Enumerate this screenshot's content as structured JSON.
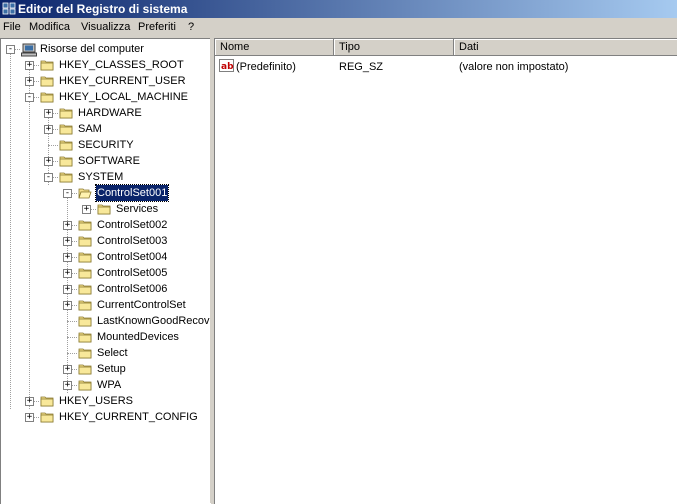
{
  "window": {
    "title": "Editor del Registro di sistema"
  },
  "menu": [
    "File",
    "Modifica",
    "Visualizza",
    "Preferiti",
    "?"
  ],
  "tree": [
    {
      "label": "Risorse del computer",
      "depth": 0,
      "expander": "-",
      "icon": "computer-icon"
    },
    {
      "label": "HKEY_CLASSES_ROOT",
      "depth": 1,
      "expander": "+"
    },
    {
      "label": "HKEY_CURRENT_USER",
      "depth": 1,
      "expander": "+"
    },
    {
      "label": "HKEY_LOCAL_MACHINE",
      "depth": 1,
      "expander": "-"
    },
    {
      "label": "HARDWARE",
      "depth": 2,
      "expander": "+"
    },
    {
      "label": "SAM",
      "depth": 2,
      "expander": "+"
    },
    {
      "label": "SECURITY",
      "depth": 2,
      "expander": ""
    },
    {
      "label": "SOFTWARE",
      "depth": 2,
      "expander": "+"
    },
    {
      "label": "SYSTEM",
      "depth": 2,
      "expander": "-"
    },
    {
      "label": "ControlSet001",
      "depth": 3,
      "expander": "-",
      "selected": true,
      "open": true
    },
    {
      "label": "Services",
      "depth": 4,
      "expander": "+"
    },
    {
      "label": "ControlSet002",
      "depth": 3,
      "expander": "+"
    },
    {
      "label": "ControlSet003",
      "depth": 3,
      "expander": "+"
    },
    {
      "label": "ControlSet004",
      "depth": 3,
      "expander": "+"
    },
    {
      "label": "ControlSet005",
      "depth": 3,
      "expander": "+"
    },
    {
      "label": "ControlSet006",
      "depth": 3,
      "expander": "+"
    },
    {
      "label": "CurrentControlSet",
      "depth": 3,
      "expander": "+"
    },
    {
      "label": "LastKnownGoodRecov",
      "depth": 3,
      "expander": ""
    },
    {
      "label": "MountedDevices",
      "depth": 3,
      "expander": ""
    },
    {
      "label": "Select",
      "depth": 3,
      "expander": ""
    },
    {
      "label": "Setup",
      "depth": 3,
      "expander": "+"
    },
    {
      "label": "WPA",
      "depth": 3,
      "expander": "+"
    },
    {
      "label": "HKEY_USERS",
      "depth": 1,
      "expander": "+"
    },
    {
      "label": "HKEY_CURRENT_CONFIG",
      "depth": 1,
      "expander": "+"
    }
  ],
  "list": {
    "columns": [
      "Nome",
      "Tipo",
      "Dati"
    ],
    "rows": [
      {
        "name": "(Predefinito)",
        "type": "REG_SZ",
        "data": "(valore non impostato)",
        "icon": "string-value-icon"
      }
    ]
  },
  "colors": {
    "title_start": "#0a246a",
    "title_end": "#a6caf0",
    "folder": "#f5e08c",
    "selection": "#0a246a"
  }
}
